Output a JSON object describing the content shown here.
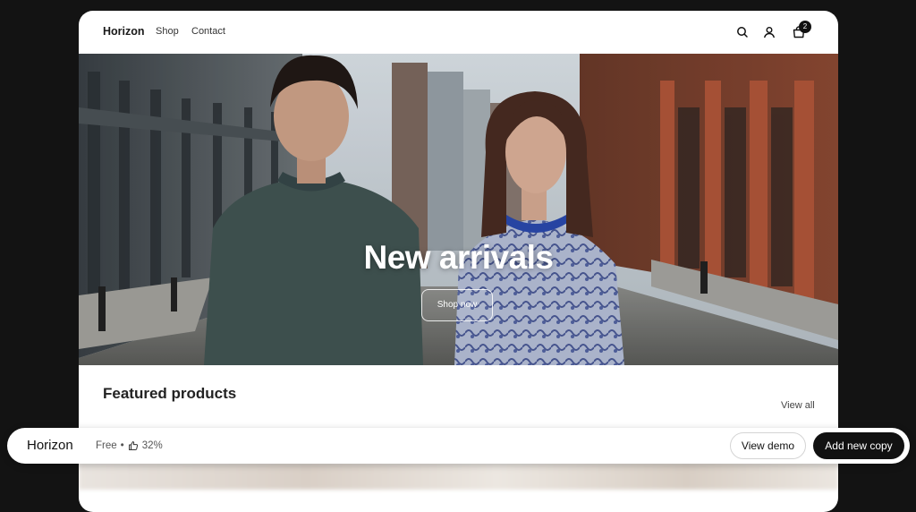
{
  "nav": {
    "brand": "Horizon",
    "links": [
      "Shop",
      "Contact"
    ],
    "icons": [
      "search-icon",
      "account-icon",
      "cart-icon"
    ],
    "cart_count": "2"
  },
  "hero": {
    "title": "New arrivals",
    "button_label": "Shop now"
  },
  "featured": {
    "title": "Featured products",
    "view_all": "View all"
  },
  "bottom_bar": {
    "theme_name": "Horizon",
    "price": "Free",
    "separator": "•",
    "rating": "32%",
    "rating_icon": "thumbs-up-icon",
    "view_demo": "View demo",
    "add_copy": "Add new copy"
  },
  "colors": {
    "page_background": "#131313",
    "primary_button": "#111111",
    "surface": "#ffffff"
  }
}
